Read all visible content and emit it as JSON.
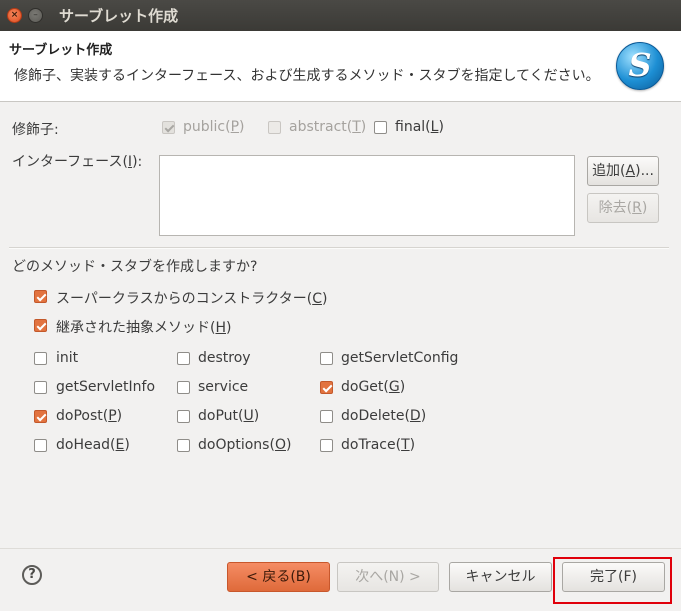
{
  "window": {
    "title": "サーブレット作成"
  },
  "header": {
    "title": "サーブレット作成",
    "description": "修飾子、実装するインターフェース、および生成するメソッド・スタブを指定してください。",
    "logo_letter": "S"
  },
  "modifiers": {
    "label": "修飾子:",
    "public": {
      "text": "public(",
      "mnemonic": "P",
      "suffix": ")",
      "checked": true,
      "enabled": false
    },
    "abstract": {
      "text": "abstract(",
      "mnemonic": "T",
      "suffix": ")",
      "checked": false,
      "enabled": false
    },
    "final": {
      "text": "final(",
      "mnemonic": "L",
      "suffix": ")",
      "checked": false,
      "enabled": true
    }
  },
  "interfaces": {
    "label_prefix": "インターフェース(",
    "label_mnemonic": "I",
    "label_suffix": "):",
    "items": [],
    "add_label": "追加(",
    "add_mnemonic": "A",
    "add_suffix": ")...",
    "remove_label": "除去(",
    "remove_mnemonic": "R",
    "remove_suffix": ")"
  },
  "stubs": {
    "question": "どのメソッド・スタブを作成しますか?",
    "superclass_ctor": {
      "text": "スーパークラスからのコンストラクター(",
      "mnemonic": "C",
      "suffix": ")",
      "checked": true
    },
    "inherited_abstract": {
      "text": "継承された抽象メソッド(",
      "mnemonic": "H",
      "suffix": ")",
      "checked": true
    },
    "methods": [
      {
        "text": "init",
        "mnemonic": "",
        "suffix": "",
        "checked": false
      },
      {
        "text": "destroy",
        "mnemonic": "",
        "suffix": "",
        "checked": false
      },
      {
        "text": "getServletConfig",
        "mnemonic": "",
        "suffix": "",
        "checked": false
      },
      {
        "text": "getServletInfo",
        "mnemonic": "",
        "suffix": "",
        "checked": false
      },
      {
        "text": "service",
        "mnemonic": "",
        "suffix": "",
        "checked": false
      },
      {
        "text": "doGet(",
        "mnemonic": "G",
        "suffix": ")",
        "checked": true
      },
      {
        "text": "doPost(",
        "mnemonic": "P",
        "suffix": ")",
        "checked": true
      },
      {
        "text": "doPut(",
        "mnemonic": "U",
        "suffix": ")",
        "checked": false
      },
      {
        "text": "doDelete(",
        "mnemonic": "D",
        "suffix": ")",
        "checked": false
      },
      {
        "text": "doHead(",
        "mnemonic": "E",
        "suffix": ")",
        "checked": false
      },
      {
        "text": "doOptions(",
        "mnemonic": "O",
        "suffix": ")",
        "checked": false
      },
      {
        "text": "doTrace(",
        "mnemonic": "T",
        "suffix": ")",
        "checked": false
      }
    ]
  },
  "footer": {
    "help_icon": "question-mark-icon",
    "help_glyph": "?",
    "back": "< 戻る(B)",
    "next": "次へ(N) >",
    "cancel": "キャンセル",
    "finish": "完了(F)"
  },
  "colors": {
    "accent": "#e2733f",
    "highlight_box": "#e0000b"
  }
}
